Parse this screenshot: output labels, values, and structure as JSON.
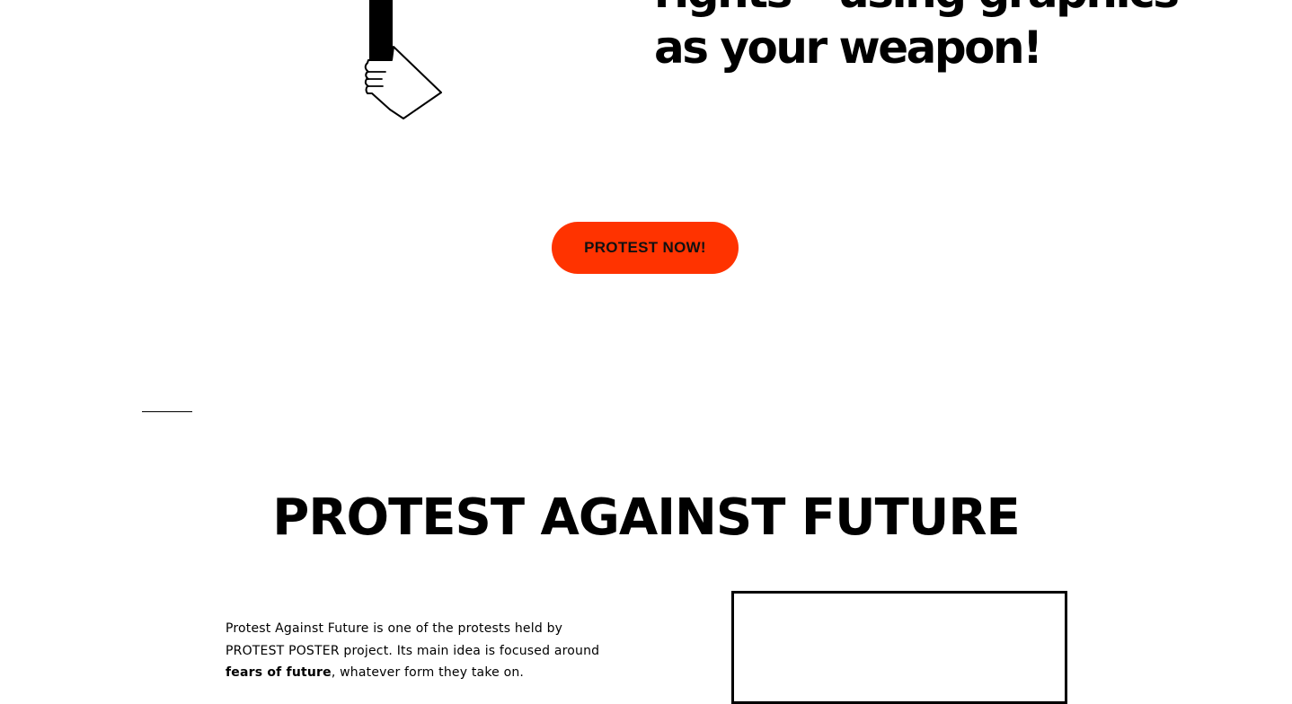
{
  "hero": {
    "headline_line1": "rights – using graphics",
    "headline_line2": "as your weapon!",
    "illustration_icon": "hand-holding-sign-icon"
  },
  "cta": {
    "label": "PROTEST NOW!",
    "color": "#ff3300"
  },
  "section": {
    "title": "PROTEST AGAINST FUTURE",
    "intro_part1": "Protest Against Future is one of the protests held by PROTEST POSTER project. Its main idea is focused around ",
    "intro_bold": "fears of future",
    "intro_part2": ", whatever form they take on."
  }
}
